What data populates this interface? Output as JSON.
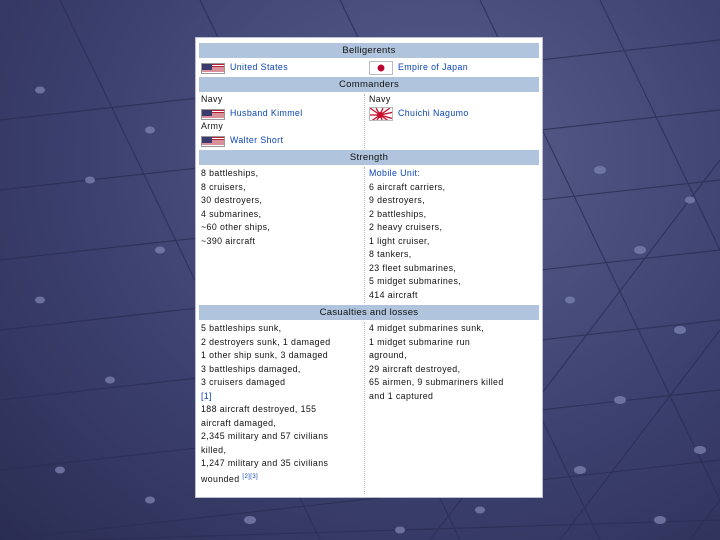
{
  "belligerents": {
    "header": "Belligerents",
    "left": "United States",
    "right": "Empire of Japan"
  },
  "commanders": {
    "header": "Commanders",
    "left_navy_label": "Navy",
    "left_navy_name": "Husband Kimmel",
    "left_army_label": "Army",
    "left_army_name": "Walter Short",
    "right_navy_label": "Navy",
    "right_navy_name": "Chuichi Nagumo"
  },
  "strength": {
    "header": "Strength",
    "left": [
      "8 battleships,",
      "8 cruisers,",
      "30 destroyers,",
      "4 submarines,",
      "~60 other ships,",
      "~390 aircraft"
    ],
    "right_title": "Mobile Unit:",
    "right": [
      "6 aircraft carriers,",
      "9 destroyers,",
      "2 battleships,",
      "2 heavy cruisers,",
      "1 light cruiser,",
      "8 tankers,",
      "23 fleet submarines,",
      "5 midget submarines,",
      "414 aircraft"
    ]
  },
  "casualties": {
    "header": "Casualties and losses",
    "left": [
      "5 battleships sunk,",
      "2 destroyers sunk, 1 damaged",
      "1 other ship sunk, 3 damaged",
      "3 battleships damaged,",
      "3 cruisers damaged",
      "[1]",
      "188 aircraft destroyed, 155",
      "aircraft damaged,",
      "2,345 military and 57 civilians",
      "killed,",
      "1,247 military and 35 civilians"
    ],
    "left_last": "wounded",
    "left_last_ref": "[2][3]",
    "right": [
      "4 midget submarines sunk,",
      "1 midget submarine run",
      "aground,",
      "29 aircraft destroyed,",
      "65 airmen, 9 submariners killed",
      "and 1 captured"
    ]
  },
  "colors": {
    "header_bg": "#b0c4de",
    "link": "#0b45b3",
    "background": "#3d4170"
  }
}
